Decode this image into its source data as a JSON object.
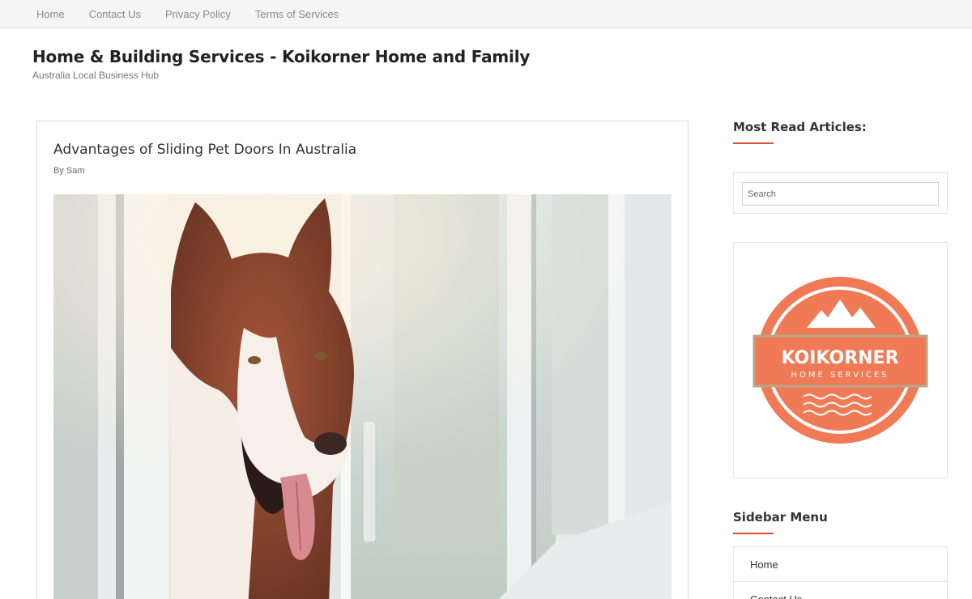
{
  "topnav": {
    "items": [
      {
        "label": "Home"
      },
      {
        "label": "Contact Us"
      },
      {
        "label": "Privacy Policy"
      },
      {
        "label": "Terms of Services"
      }
    ]
  },
  "site": {
    "title": "Home & Building Services - Koikorner Home and Family",
    "description": "Australia Local Business Hub"
  },
  "article": {
    "title": "Advantages of Sliding Pet Doors In Australia",
    "byline": "By Sam"
  },
  "sidebar": {
    "most_read_title": "Most Read Articles:",
    "search_placeholder": "Search",
    "logo": {
      "name": "KOIKORNER",
      "tagline": "HOME SERVICES"
    },
    "menu_title": "Sidebar Menu",
    "menu_items": [
      {
        "label": "Home"
      },
      {
        "label": "Contact Us"
      }
    ]
  },
  "colors": {
    "accent": "#e04b3c",
    "logo_orange": "#f07a55",
    "logo_band": "#f07a55",
    "logo_band_border": "#b8a586"
  }
}
